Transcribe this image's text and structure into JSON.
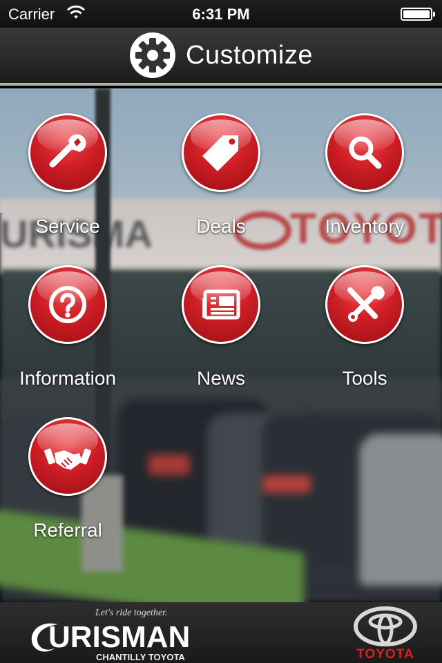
{
  "status_bar": {
    "carrier": "Carrier",
    "time": "6:31 PM",
    "wifi_icon": "wifi-icon",
    "battery_icon": "battery-icon",
    "battery_level": 1.0
  },
  "header": {
    "title": "Customize",
    "icon": "gear-icon"
  },
  "menu": [
    {
      "label": "Service",
      "icon": "wrench-icon"
    },
    {
      "label": "Deals",
      "icon": "price-tag-icon"
    },
    {
      "label": "Inventory",
      "icon": "magnifier-icon"
    },
    {
      "label": "Information",
      "icon": "question-icon"
    },
    {
      "label": "News",
      "icon": "newspaper-icon"
    },
    {
      "label": "Tools",
      "icon": "tools-icon"
    },
    {
      "label": "Referral",
      "icon": "handshake-icon"
    }
  ],
  "footer": {
    "tagline": "Let's ride together.",
    "dealer_name": "URISMAN",
    "dealer_location": "CHANTILLY TOYOTA",
    "brand": "TOYOTA"
  },
  "colors": {
    "button_red": "#cf1e26",
    "brand_red": "#e31c23",
    "header_bg": "#2a2a2a"
  }
}
